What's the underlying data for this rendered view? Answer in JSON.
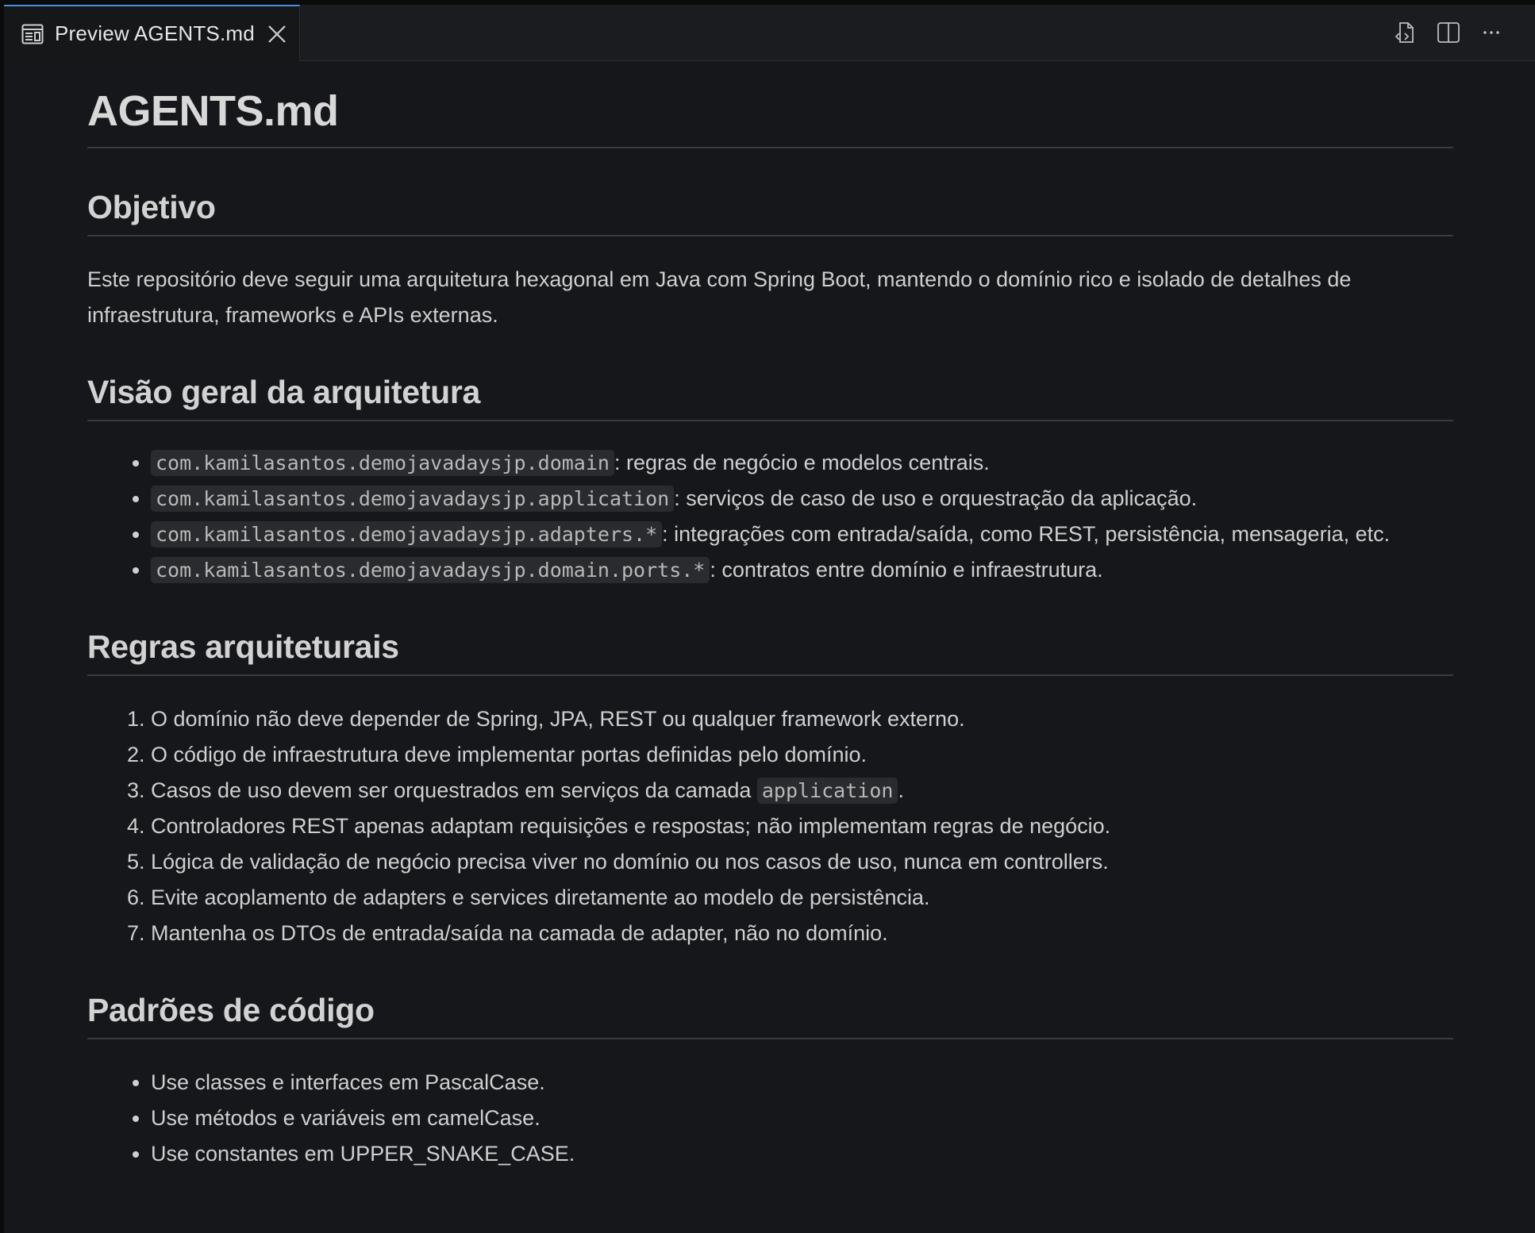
{
  "tab": {
    "label": "Preview AGENTS.md",
    "icon": "preview-icon",
    "close_icon": "close-icon"
  },
  "actions": [
    {
      "name": "open-source-icon"
    },
    {
      "name": "split-editor-icon"
    },
    {
      "name": "more-actions-icon"
    }
  ],
  "doc": {
    "title": "AGENTS.md",
    "sections": {
      "objetivo": {
        "heading": "Objetivo",
        "paragraph": "Este repositório deve seguir uma arquitetura hexagonal em Java com Spring Boot, mantendo o domínio rico e isolado de detalhes de infraestrutura, frameworks e APIs externas."
      },
      "visao": {
        "heading": "Visão geral da arquitetura",
        "items": [
          {
            "code": "com.kamilasantos.demojavadaysjp.domain",
            "text": ": regras de negócio e modelos centrais."
          },
          {
            "code": "com.kamilasantos.demojavadaysjp.application",
            "text": ": serviços de caso de uso e orquestração da aplicação."
          },
          {
            "code": "com.kamilasantos.demojavadaysjp.adapters.*",
            "text": ": integrações com entrada/saída, como REST, persistência, mensageria, etc."
          },
          {
            "code": "com.kamilasantos.demojavadaysjp.domain.ports.*",
            "text": ": contratos entre domínio e infraestrutura."
          }
        ]
      },
      "regras": {
        "heading": "Regras arquiteturais",
        "items": [
          {
            "text": "O domínio não deve depender de Spring, JPA, REST ou qualquer framework externo."
          },
          {
            "text": "O código de infraestrutura deve implementar portas definidas pelo domínio."
          },
          {
            "text_before": "Casos de uso devem ser orquestrados em serviços da camada ",
            "code": "application",
            "text_after": "."
          },
          {
            "text": "Controladores REST apenas adaptam requisições e respostas; não implementam regras de negócio."
          },
          {
            "text": "Lógica de validação de negócio precisa viver no domínio ou nos casos de uso, nunca em controllers."
          },
          {
            "text": "Evite acoplamento de adapters e services diretamente ao modelo de persistência."
          },
          {
            "text": "Mantenha os DTOs de entrada/saída na camada de adapter, não no domínio."
          }
        ]
      },
      "padroes": {
        "heading": "Padrões de código",
        "items": [
          {
            "text": "Use classes e interfaces em PascalCase."
          },
          {
            "text": "Use métodos e variáveis em camelCase."
          },
          {
            "text": "Use constantes em UPPER_SNAKE_CASE."
          }
        ]
      }
    }
  }
}
